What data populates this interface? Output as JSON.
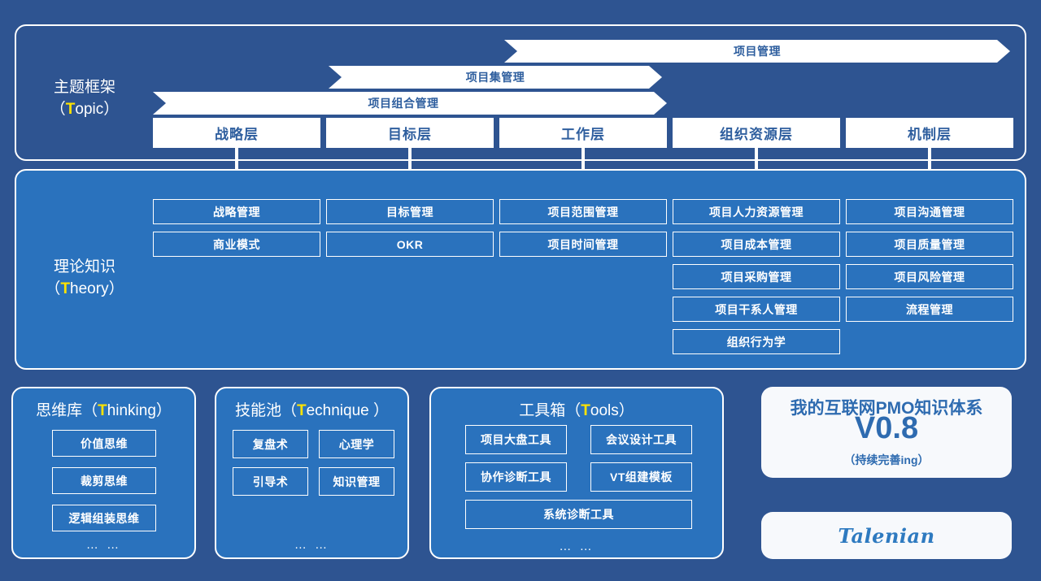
{
  "topic_section": {
    "caption_cn": "主题框架",
    "caption_en_open": "（",
    "caption_en_hl": "T",
    "caption_en_rest": "opic）",
    "banners": [
      {
        "label": "项目管理"
      },
      {
        "label": "项目集管理"
      },
      {
        "label": "项目组合管理"
      }
    ],
    "layers": [
      {
        "label": "战略层"
      },
      {
        "label": "目标层"
      },
      {
        "label": "工作层"
      },
      {
        "label": "组织资源层"
      },
      {
        "label": "机制层"
      }
    ]
  },
  "theory_section": {
    "caption_cn": "理论知识",
    "caption_en_open": "（",
    "caption_en_hl": "T",
    "caption_en_rest": "heory）",
    "columns": [
      {
        "layer": "战略层",
        "items": [
          "战略管理",
          "商业模式"
        ]
      },
      {
        "layer": "目标层",
        "items": [
          "目标管理",
          "OKR"
        ]
      },
      {
        "layer": "工作层",
        "items": [
          "项目范围管理",
          "项目时间管理"
        ]
      },
      {
        "layer": "组织资源层",
        "items": [
          "项目人力资源管理",
          "项目成本管理",
          "项目采购管理",
          "项目干系人管理",
          "组织行为学"
        ]
      },
      {
        "layer": "机制层",
        "items": [
          "项目沟通管理",
          "项目质量管理",
          "项目风险管理",
          "流程管理"
        ]
      }
    ]
  },
  "bottom_panels": [
    {
      "title_cn": "思维库（",
      "title_hl": "T",
      "title_rest": "hinking）",
      "layout": "single",
      "items": [
        "价值思维",
        "裁剪思维",
        "逻辑组装思维"
      ],
      "dots": "… …"
    },
    {
      "title_cn": "技能池（",
      "title_hl": "T",
      "title_rest": "echnique ）",
      "layout": "double",
      "items": [
        "复盘术",
        "心理学",
        "引导术",
        "知识管理"
      ],
      "dots": "… …"
    },
    {
      "title_cn": "工具箱（",
      "title_hl": "T",
      "title_rest": "ools）",
      "layout": "tools",
      "items": [
        "项目大盘工具",
        "会议设计工具",
        "协作诊断工具",
        "VT组建模板",
        "系统诊断工具"
      ],
      "dots": "… …"
    }
  ],
  "version_card": {
    "title": "我的互联网PMO知识体系",
    "version": "V0.8",
    "subtitle": "（持续完善ing）"
  },
  "logo_card": {
    "text": "Talenian"
  },
  "colors": {
    "background": "#2e5491",
    "panel_light": "#2a72bd",
    "accent_yellow": "#ffe300",
    "text_blue": "#2e6bb0",
    "white": "#ffffff"
  }
}
